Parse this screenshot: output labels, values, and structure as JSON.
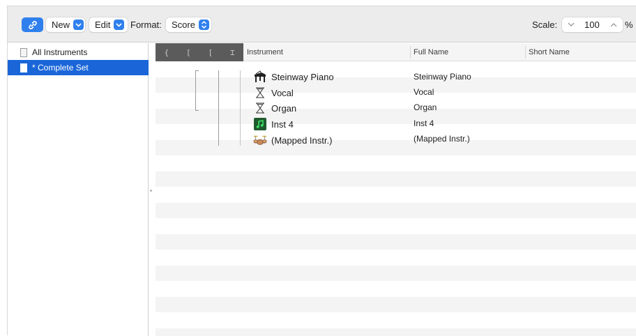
{
  "toolbar": {
    "new_label": "New",
    "edit_label": "Edit",
    "format_label": "Format:",
    "format_value": "Score",
    "scale_label": "Scale:",
    "scale_value": "100",
    "scale_unit": "%"
  },
  "sidebar": {
    "items": [
      {
        "label": "All Instruments",
        "selected": false
      },
      {
        "label": "* Complete Set",
        "selected": true
      }
    ]
  },
  "table": {
    "columns": {
      "brace_icons": [
        "{",
        "[",
        "[",
        "⌶"
      ],
      "instrument": "Instrument",
      "full_name": "Full Name",
      "short_name": "Short Name"
    },
    "rows": [
      {
        "name": "Steinway Piano",
        "full_name": "Steinway Piano",
        "short_name": "",
        "icon": "piano-icon"
      },
      {
        "name": "Vocal",
        "full_name": "Vocal",
        "short_name": "",
        "icon": "hourglass-icon"
      },
      {
        "name": "Organ",
        "full_name": "Organ",
        "short_name": "",
        "icon": "hourglass-icon"
      },
      {
        "name": "Inst 4",
        "full_name": "Inst 4",
        "short_name": "",
        "icon": "music-note-icon"
      },
      {
        "name": "(Mapped Instr.)",
        "full_name": "(Mapped Instr.)",
        "short_name": "",
        "icon": "drum-kit-icon"
      }
    ]
  },
  "colors": {
    "accent": "#2f80ed",
    "selection": "#1a66d9",
    "header_dark": "#5b5b5b"
  }
}
